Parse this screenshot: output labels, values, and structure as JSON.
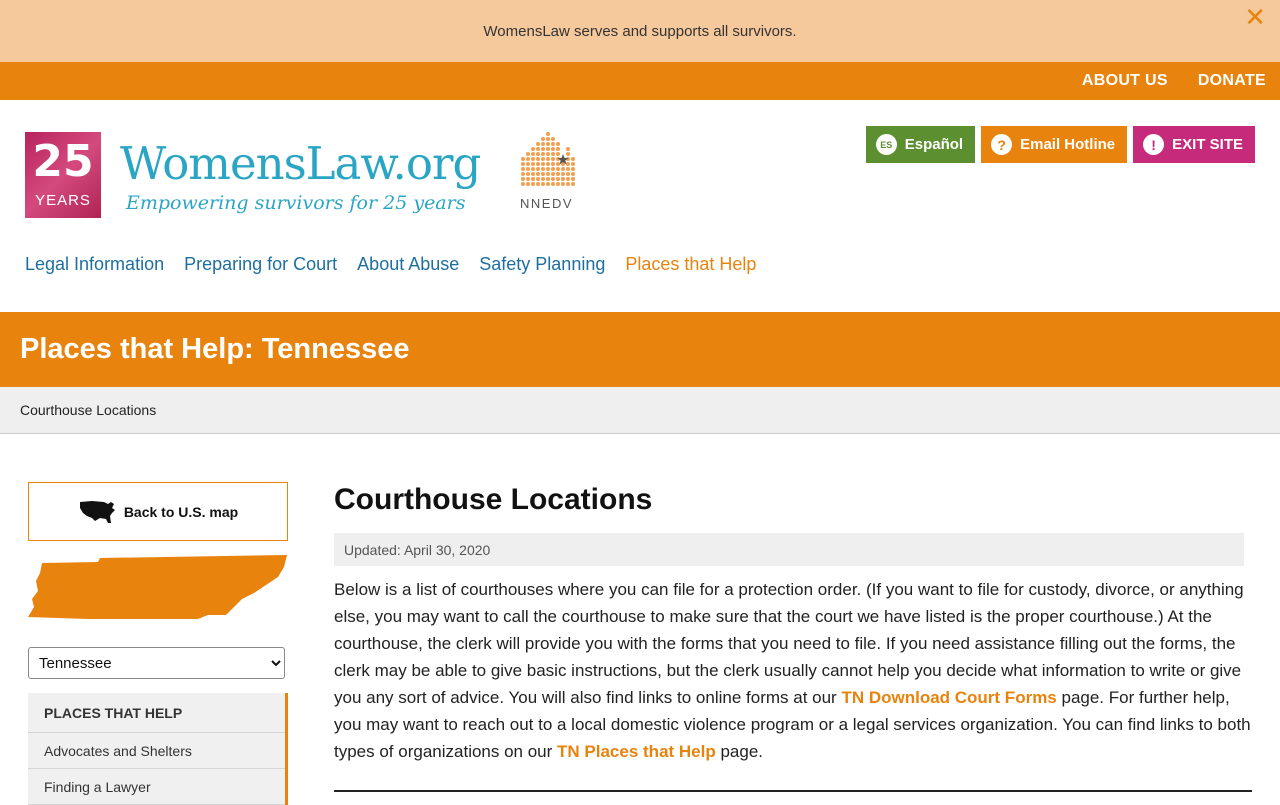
{
  "banner": {
    "text": "WomensLaw serves and supports all survivors.",
    "close_symbol": "✕"
  },
  "topbar": {
    "about": "ABOUT US",
    "donate": "DONATE"
  },
  "logo": {
    "badge_number": "25",
    "badge_word": "YEARS",
    "name": "WomensLaw.org",
    "tagline": "Empowering survivors for 25 years",
    "partner": "NNEDV"
  },
  "header_buttons": {
    "espanol": {
      "icon_text": "ES",
      "label": "Español"
    },
    "hotline": {
      "icon_text": "?",
      "label": "Email Hotline"
    },
    "exit": {
      "icon_text": "!",
      "label": "EXIT SITE"
    }
  },
  "nav": {
    "items": [
      "Legal Information",
      "Preparing for Court",
      "About Abuse",
      "Safety Planning",
      "Places that Help"
    ]
  },
  "page": {
    "title": "Places that Help: Tennessee",
    "breadcrumb": "Courthouse Locations"
  },
  "sidebar": {
    "back_label": "Back to U.S. map",
    "selected_state": "Tennessee",
    "menu_heading": "PLACES THAT HELP",
    "menu_items": [
      "Advocates and Shelters",
      "Finding a Lawyer"
    ]
  },
  "content": {
    "heading": "Courthouse Locations",
    "updated": "Updated: April 30, 2020",
    "p1": "Below is a list of courthouses where you can file for a protection order. (If you want to file for custody, divorce, or anything else, you may want to call the courthouse to make sure that the court we have listed is the proper courthouse.) At the courthouse, the clerk will provide you with the forms that you need to file. If you need assistance filling out the forms, the clerk may be able to give basic instructions, but the clerk usually cannot help you decide what information to write or give you any sort of advice. You will also find links to online forms at our ",
    "link1": "TN Download Court Forms",
    "p2": " page. For further help, you may want to reach out to a local domestic violence program or a legal services organization. You can find links to both types of organizations on our ",
    "link2": "TN Places that Help",
    "p3": " page."
  },
  "colors": {
    "accent": "#e8830e",
    "link": "#1d6fa0",
    "brand_teal": "#2aa6c4",
    "espanol": "#5c8f2f",
    "exit": "#c62a7a",
    "banner": "#f6c99c"
  },
  "icons": {
    "close": "close-icon",
    "usa_map": "usa-map-icon",
    "state_map": "tennessee-map-icon",
    "chevron": "chevron-down-icon"
  }
}
